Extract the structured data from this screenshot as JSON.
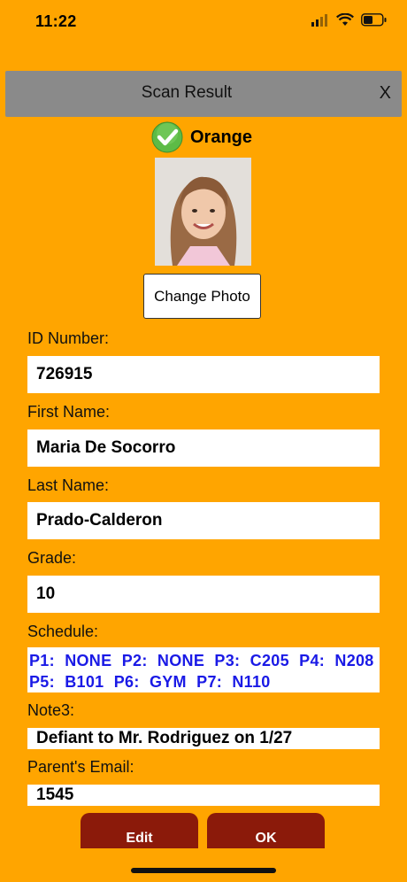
{
  "status": {
    "time": "11:22"
  },
  "header": {
    "title": "Scan Result",
    "close": "X"
  },
  "house": {
    "label": "Orange"
  },
  "photo": {
    "change_label": "Change Photo"
  },
  "fields": {
    "id_label": "ID Number:",
    "id_value": "726915",
    "first_label": "First Name:",
    "first_value": "Maria De Socorro",
    "last_label": "Last Name:",
    "last_value": "Prado-Calderon",
    "grade_label": "Grade:",
    "grade_value": "10",
    "schedule_label": "Schedule:",
    "schedule_value": " P1: NONE P2: NONE P3: C205 P4: N208 P5: B101 P6: GYM P7: N110",
    "note_label": "Note3:",
    "note_value": "Defiant to Mr. Rodriguez on 1/27",
    "email_label": "Parent's Email:",
    "email_value": "1545"
  },
  "buttons": {
    "edit": "Edit",
    "ok": "OK"
  },
  "colors": {
    "background": "#FFA500",
    "header": "#8A8A8A",
    "button": "#8B1A0A",
    "schedule_text": "#1A1AE6"
  }
}
